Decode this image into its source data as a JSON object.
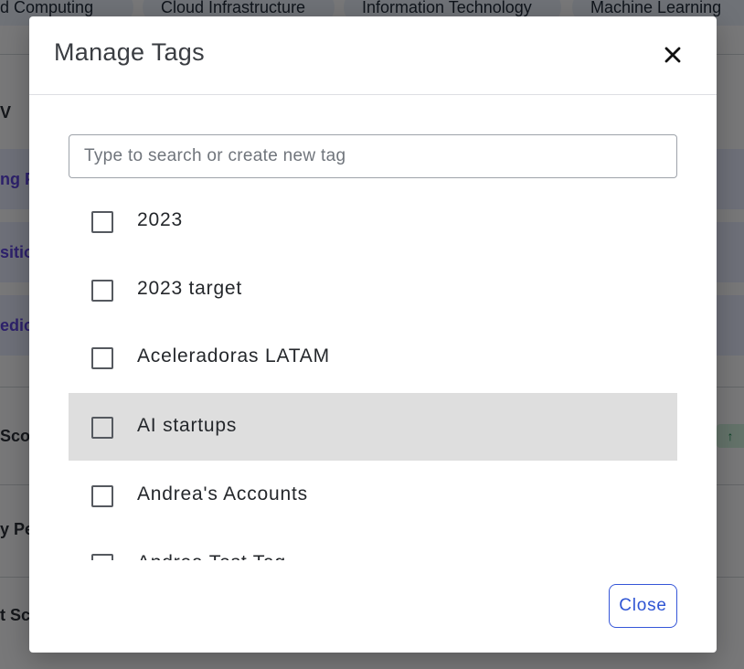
{
  "background": {
    "chips": [
      "oud Computing",
      "Cloud Infrastructure",
      "Information Technology",
      "Machine Learning"
    ],
    "side_texts": [
      "V",
      "ng P",
      "sitio",
      "edic",
      "Scor",
      "y Pe",
      "t Sc"
    ],
    "trend_badge_icon": "arrow-up-icon",
    "trend_badge_glyph": "↑"
  },
  "modal": {
    "title": "Manage Tags",
    "close_icon": "close-icon",
    "search": {
      "value": "",
      "placeholder": "Type to search or create new tag"
    },
    "tags": [
      {
        "label": "2023",
        "checked": false
      },
      {
        "label": "2023 target",
        "checked": false
      },
      {
        "label": "Aceleradoras LATAM",
        "checked": false
      },
      {
        "label": "AI startups",
        "checked": false,
        "hovered": true
      },
      {
        "label": "Andrea's Accounts",
        "checked": false
      },
      {
        "label": "Andrea Test Tag",
        "checked": false
      }
    ],
    "close_button_label": "Close"
  },
  "colors": {
    "accent": "#2f55d4",
    "hover_row": "#dedede",
    "background_link": "#5b43d6"
  }
}
